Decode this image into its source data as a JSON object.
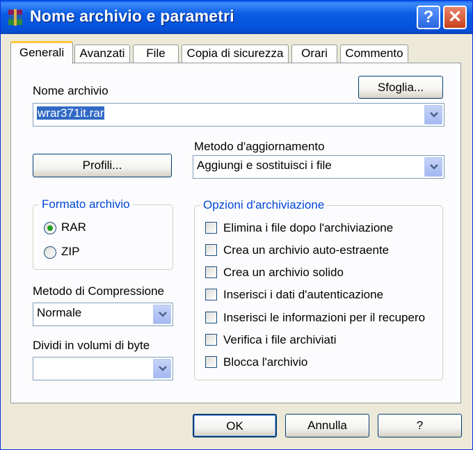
{
  "window": {
    "title": "Nome archivio e parametri",
    "help_glyph": "?",
    "close_glyph": "✕"
  },
  "tabs": [
    "Generali",
    "Avanzati",
    "File",
    "Copia di sicurezza",
    "Orari",
    "Commento"
  ],
  "archive": {
    "label": "Nome archivio",
    "value": "wrar371it.rar",
    "browse_button": "Sfoglia..."
  },
  "profiles_button": "Profili...",
  "update_method": {
    "label": "Metodo d'aggiornamento",
    "value": "Aggiungi e sostituisci i file"
  },
  "format": {
    "title": "Formato archivio",
    "options": [
      {
        "label": "RAR",
        "selected": true
      },
      {
        "label": "ZIP",
        "selected": false
      }
    ]
  },
  "compression": {
    "label": "Metodo di Compressione",
    "value": "Normale"
  },
  "split": {
    "label": "Dividi in volumi di byte",
    "value": ""
  },
  "archiving_options": {
    "title": "Opzioni d'archiviazione",
    "items": [
      {
        "label": "Elimina i file dopo l'archiviazione",
        "checked": false
      },
      {
        "label": "Crea un archivio auto-estraente",
        "checked": false
      },
      {
        "label": "Crea un archivio solido",
        "checked": false
      },
      {
        "label": "Inserisci i dati d'autenticazione",
        "checked": false
      },
      {
        "label": "Inserisci le informazioni per il recupero",
        "checked": false
      },
      {
        "label": "Verifica i file archiviati",
        "checked": false
      },
      {
        "label": "Blocca l'archivio",
        "checked": false
      }
    ]
  },
  "footer": {
    "ok": "OK",
    "cancel": "Annulla",
    "help": "?"
  },
  "colors": {
    "title_bar": "#0a5ee8",
    "group_title": "#0046d5",
    "dialog_bg": "#ece9d8",
    "selection": "#316ac5"
  }
}
